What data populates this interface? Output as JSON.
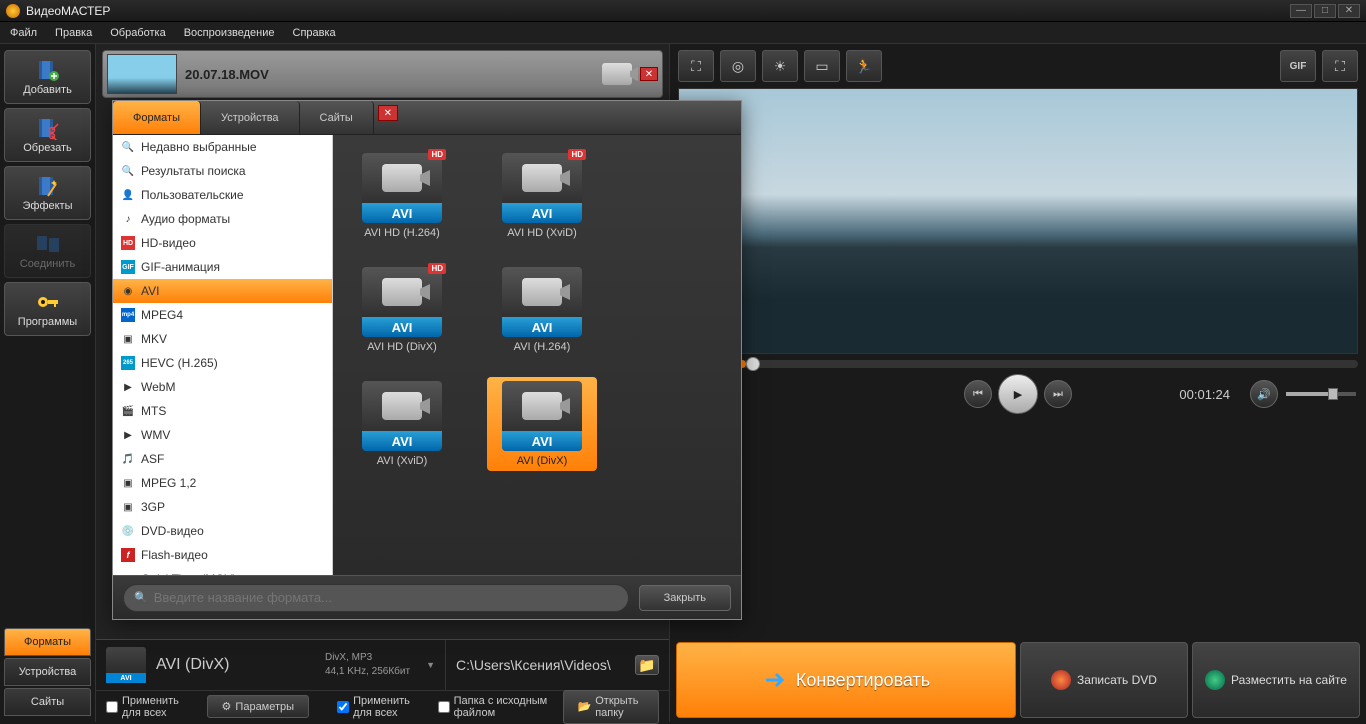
{
  "app": {
    "title": "ВидеоМАСТЕР"
  },
  "menu": [
    "Файл",
    "Правка",
    "Обработка",
    "Воспроизведение",
    "Справка"
  ],
  "side": {
    "add": "Добавить",
    "cut": "Обрезать",
    "fx": "Эффекты",
    "join": "Соединить",
    "prog": "Программы"
  },
  "lefttabs": {
    "formats": "Форматы",
    "devices": "Устройства",
    "sites": "Сайты"
  },
  "file": {
    "name": "20.07.18.MOV"
  },
  "bottom": {
    "fmt_name": "AVI (DivX)",
    "fmt_codec": "DivX, MP3",
    "fmt_detail": "44,1 KHz,  256Кбит",
    "path": "C:\\Users\\Ксения\\Videos\\",
    "apply_all": "Применить для всех",
    "src_folder": "Папка с исходным файлом",
    "params": "Параметры",
    "open_folder": "Открыть папку"
  },
  "right": {
    "time": "00:01:24",
    "gif": "GIF",
    "convert": "Конвертировать",
    "burn": "Записать DVD",
    "publish": "Разместить на сайте"
  },
  "popup": {
    "tabs": {
      "formats": "Форматы",
      "devices": "Устройства",
      "sites": "Сайты"
    },
    "cats": [
      {
        "icon": "🔍",
        "label": "Недавно выбранные"
      },
      {
        "icon": "🔍",
        "label": "Результаты поиска"
      },
      {
        "icon": "👤",
        "label": "Пользовательские"
      },
      {
        "icon": "♪",
        "label": "Аудио форматы"
      },
      {
        "icon": "HD",
        "label": "HD-видео",
        "badge": "hd"
      },
      {
        "icon": "GIF",
        "label": "GIF-анимация",
        "badge": "gif"
      },
      {
        "icon": "◉",
        "label": "AVI",
        "active": true
      },
      {
        "icon": "mp4",
        "label": "MPEG4",
        "badge": "mp4"
      },
      {
        "icon": "▣",
        "label": "MKV"
      },
      {
        "icon": "265",
        "label": "HEVC (H.265)",
        "badge": "265"
      },
      {
        "icon": "▶",
        "label": "WebM"
      },
      {
        "icon": "🎬",
        "label": "MTS"
      },
      {
        "icon": "▶",
        "label": "WMV"
      },
      {
        "icon": "🎵",
        "label": "ASF"
      },
      {
        "icon": "▣",
        "label": "MPEG 1,2"
      },
      {
        "icon": "▣",
        "label": "3GP"
      },
      {
        "icon": "💿",
        "label": "DVD-видео"
      },
      {
        "icon": "f",
        "label": "Flash-видео",
        "badge": "flash"
      },
      {
        "icon": "Q",
        "label": "QuickTime (MOV)",
        "badge": "qt"
      }
    ],
    "items": [
      {
        "label": "AVI",
        "cap": "AVI HD (H.264)",
        "hd": true
      },
      {
        "label": "AVI",
        "cap": "AVI HD (XviD)",
        "hd": true
      },
      {
        "label": "AVI",
        "cap": "AVI HD (DivX)",
        "hd": true
      },
      {
        "label": "AVI",
        "cap": "AVI (H.264)"
      },
      {
        "label": "AVI",
        "cap": "AVI (XviD)"
      },
      {
        "label": "AVI",
        "cap": "AVI (DivX)",
        "sel": true
      }
    ],
    "search_placeholder": "Введите название формата...",
    "close": "Закрыть"
  }
}
